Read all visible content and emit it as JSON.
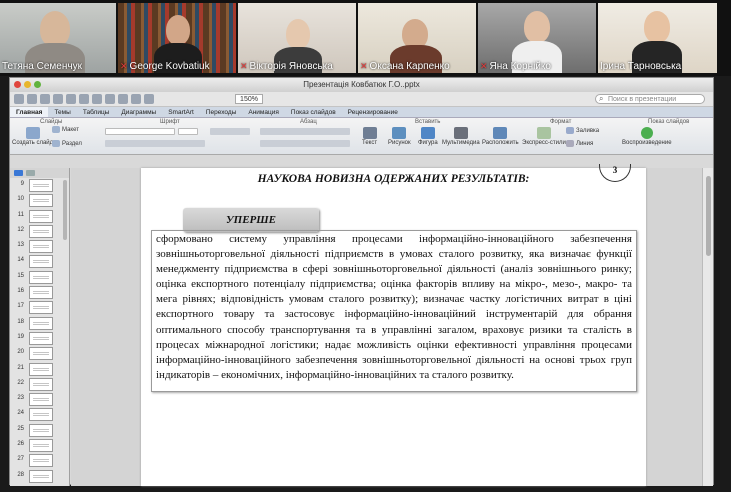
{
  "participants": [
    {
      "name": "Тетяна Семенчук",
      "muted": false
    },
    {
      "name": "George Kovbatiuk",
      "muted": true
    },
    {
      "name": "Вікторія Яновська",
      "muted": true
    },
    {
      "name": "Оксана Карпенко",
      "muted": true
    },
    {
      "name": "Яна Корнійко",
      "muted": true
    },
    {
      "name": "Ірина Тарновська",
      "muted": false
    }
  ],
  "window": {
    "title": "Презентація Ковбатюк Г.О..pptx",
    "zoom": "150%",
    "search_placeholder": "Поиск в презентации"
  },
  "ribbon": {
    "tabs": [
      "Главная",
      "Темы",
      "Таблицы",
      "Диаграммы",
      "SmartArt",
      "Переходы",
      "Анимация",
      "Показ слайдов",
      "Рецензирование"
    ],
    "groups": [
      "Слайды",
      "Шрифт",
      "Абзац",
      "Вставить",
      "Формат",
      "Показ слайдов"
    ],
    "buttons": {
      "create_slide": "Создать слайд",
      "layout": "Макет",
      "section": "Раздел",
      "text": "Текст",
      "picture": "Рисунок",
      "shape": "Фигура",
      "media": "Мультимедиа",
      "arrange": "Расположить",
      "quick_styles": "Экспресс-стили",
      "fill": "Заливка",
      "line": "Линия",
      "play": "Воспроизведение"
    }
  },
  "thumbnails": [
    "9",
    "10",
    "11",
    "12",
    "13",
    "14",
    "15",
    "16",
    "17",
    "18",
    "19",
    "20",
    "21",
    "22",
    "23",
    "24",
    "25",
    "26",
    "27",
    "28"
  ],
  "slide": {
    "title": "НАУКОВА НОВИЗНА ОДЕРЖАНИХ РЕЗУЛЬТАТІВ:",
    "page_number": "3",
    "label": "УПЕРШЕ",
    "body": "сформовано систему управління процесами інформаційно-інноваційного забезпечення зовнішньоторговельної діяльності підприємств в умовах сталого розвитку, яка визначає функції менеджменту підприємства в сфері зовнішньоторговельної діяльності (аналіз зовнішнього ринку; оцінка експортного потенціалу підприємства; оцінка факторів впливу на мікро-, мезо-, макро- та мега рівнях; відповідність умовам сталого розвитку); визначає частку логістичних витрат в ціні експортного товару та застосовує інформаційно-інноваційний інструментарій для обрання оптимального способу транспортування та в управлінні загалом, враховує ризики та сталість в процесах міжнародної логістики; надає можливість оцінки ефективності управління процесами інформаційно-інноваційного забезпечення зовнішньоторговельної діяльності на основі трьох груп індикаторів – економічних, інформаційно-інноваційних та сталого розвитку."
  },
  "colors": {
    "active_speaker_outline": "#d6e94a",
    "muted_icon": "#e23b3b"
  }
}
